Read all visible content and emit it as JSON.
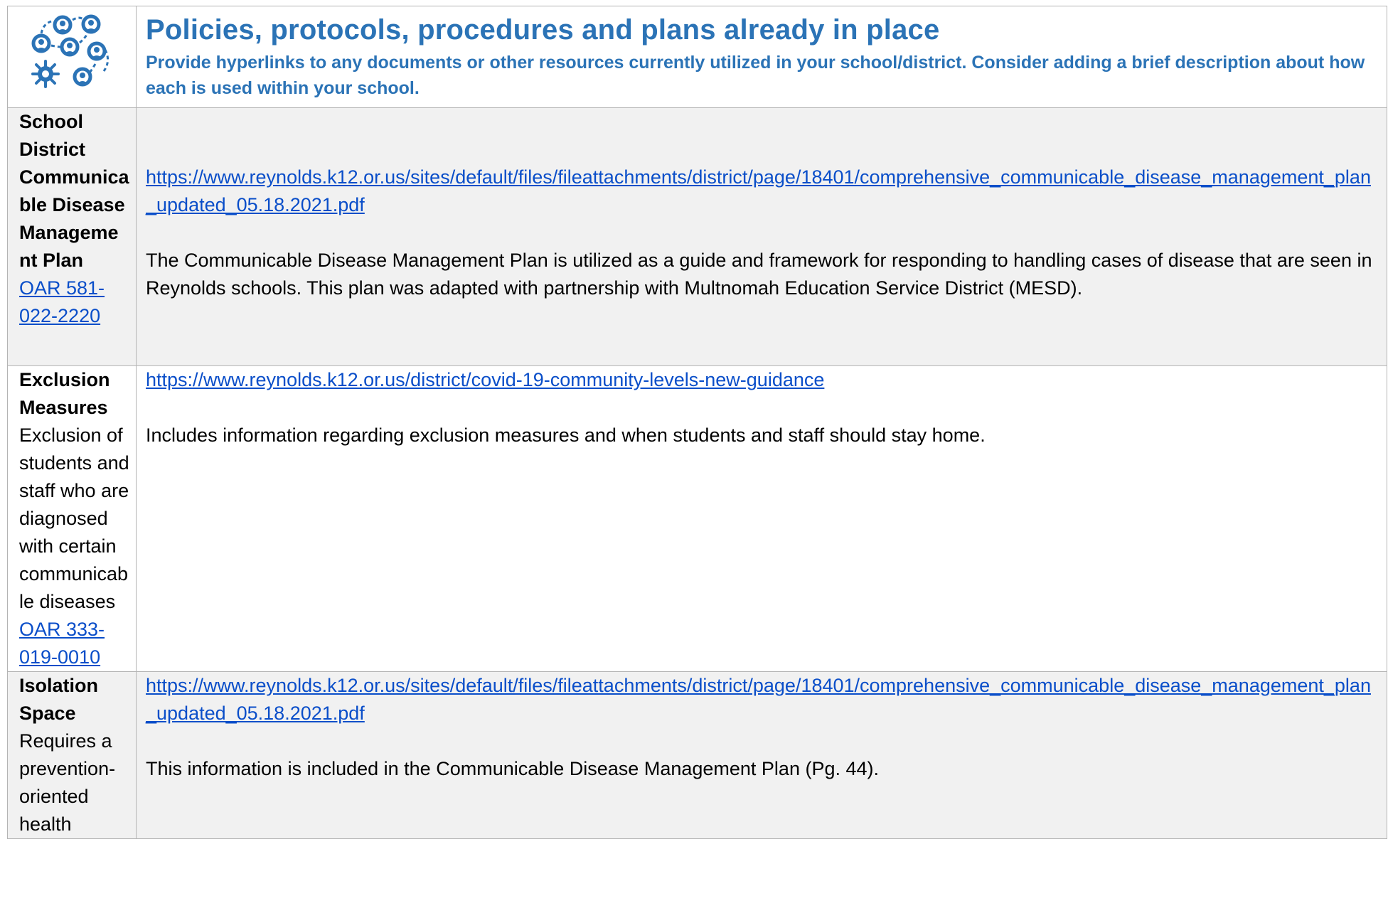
{
  "header": {
    "icon": "people-network-icon",
    "title": "Policies, protocols, procedures and plans already in place",
    "subtitle": "Provide hyperlinks to any documents or other resources currently utilized in your school/district. Consider adding a brief description about how each is used within your school."
  },
  "rows": [
    {
      "label_bold": "School District Communicable Disease Management Plan",
      "label_plain": "",
      "label_link": "OAR 581-022-2220",
      "link": "https://www.reynolds.k12.or.us/sites/default/files/fileattachments/district/page/18401/comprehensive_communicable_disease_management_plan_updated_05.18.2021.pdf",
      "description": "The Communicable Disease Management Plan is utilized as a guide and framework for responding to handling cases of disease that are seen in Reynolds schools. This plan was adapted with partnership with Multnomah Education Service District (MESD)."
    },
    {
      "label_bold": "Exclusion Measures",
      "label_plain": "Exclusion of students and staff who are diagnosed with certain communicable diseases",
      "label_link": "OAR 333-019-0010",
      "link": "https://www.reynolds.k12.or.us/district/covid-19-community-levels-new-guidance",
      "description": "Includes information regarding exclusion measures and when students and staff should stay home."
    },
    {
      "label_bold": "Isolation Space",
      "label_plain": "Requires a prevention-oriented health",
      "label_link": "",
      "link": "https://www.reynolds.k12.or.us/sites/default/files/fileattachments/district/page/18401/comprehensive_communicable_disease_management_plan_updated_05.18.2021.pdf",
      "description": "This information is included in the Communicable Disease Management Plan (Pg. 44)."
    }
  ],
  "colors": {
    "heading_blue": "#2b73b6",
    "link_blue": "#0a4ec9",
    "row_gray": "#f1f1f1",
    "border": "#b4b4b4"
  }
}
